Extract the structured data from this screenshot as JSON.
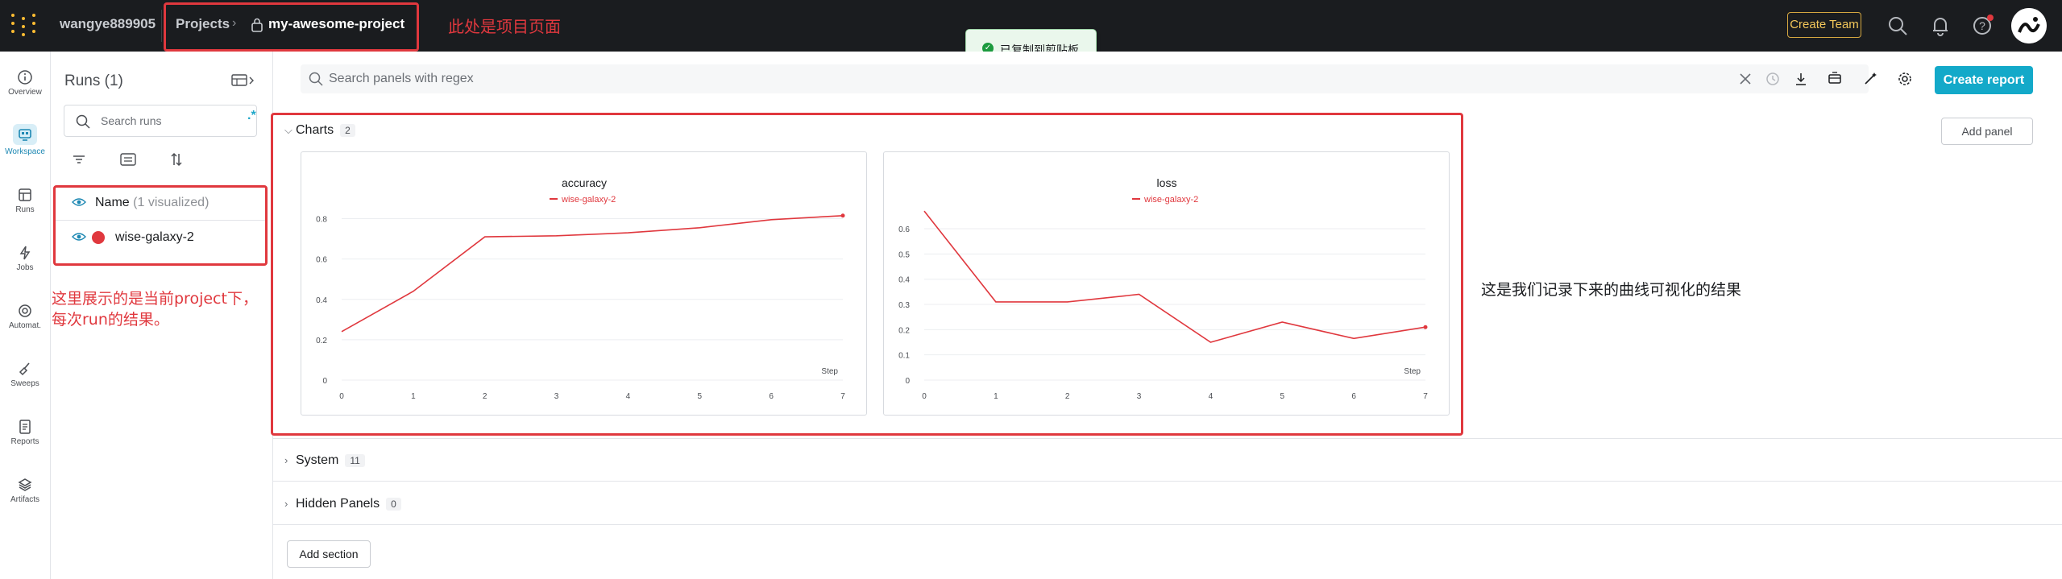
{
  "topbar": {
    "user": "wangye889905",
    "breadcrumb_projects": "Projects",
    "project_name": "my-awesome-project",
    "annotation": "此处是项目页面",
    "create_team": "Create Team"
  },
  "toast": {
    "text": "已复制到剪贴板"
  },
  "leftnav": {
    "items": [
      {
        "label": "Overview",
        "icon": "info-icon"
      },
      {
        "label": "Workspace",
        "icon": "workspace-icon"
      },
      {
        "label": "Runs",
        "icon": "table-icon"
      },
      {
        "label": "Jobs",
        "icon": "lightning-icon"
      },
      {
        "label": "Automat.",
        "icon": "automation-icon"
      },
      {
        "label": "Sweeps",
        "icon": "broom-icon"
      },
      {
        "label": "Reports",
        "icon": "report-icon"
      },
      {
        "label": "Artifacts",
        "icon": "layers-icon"
      }
    ]
  },
  "runs_panel": {
    "title": "Runs (1)",
    "search_placeholder": "Search runs",
    "regex_symbol": ".*",
    "header_name": "Name",
    "header_visualized": "(1 visualized)",
    "run_name": "wise-galaxy-2",
    "run_color": "#e0383e",
    "annotation_line1": "这里展示的是当前project下，",
    "annotation_line2": "每次run的结果。"
  },
  "main": {
    "search_placeholder": "Search panels with regex",
    "create_report": "Create report",
    "add_panel": "Add panel",
    "add_section": "Add section",
    "sections": [
      {
        "name": "Charts",
        "count": "2"
      },
      {
        "name": "System",
        "count": "11"
      },
      {
        "name": "Hidden Panels",
        "count": "0"
      }
    ],
    "annotation_right": "这是我们记录下来的曲线可视化的结果"
  },
  "chart_data": [
    {
      "type": "line",
      "title": "accuracy",
      "xlabel": "Step",
      "ylabel": "",
      "x": [
        0,
        1,
        2,
        3,
        4,
        5,
        6,
        7
      ],
      "xticks": [
        "0",
        "1",
        "2",
        "3",
        "4",
        "5",
        "6",
        "7"
      ],
      "yticks": [
        "0",
        "0.2",
        "0.4",
        "0.6",
        "0.8"
      ],
      "ylim": [
        0,
        0.85
      ],
      "series": [
        {
          "name": "wise-galaxy-2",
          "color": "#e0383e",
          "values": [
            0.24,
            0.44,
            0.71,
            0.715,
            0.73,
            0.755,
            0.795,
            0.815
          ]
        }
      ],
      "legend": "top-center",
      "grid": true
    },
    {
      "type": "line",
      "title": "loss",
      "xlabel": "Step",
      "ylabel": "",
      "x": [
        0,
        1,
        2,
        3,
        4,
        5,
        6,
        7
      ],
      "xticks": [
        "0",
        "1",
        "2",
        "3",
        "4",
        "5",
        "6",
        "7"
      ],
      "yticks": [
        "0",
        "0.1",
        "0.2",
        "0.3",
        "0.4",
        "0.5",
        "0.6"
      ],
      "ylim": [
        0,
        0.68
      ],
      "series": [
        {
          "name": "wise-galaxy-2",
          "color": "#e0383e",
          "values": [
            0.67,
            0.31,
            0.31,
            0.34,
            0.15,
            0.23,
            0.165,
            0.21
          ]
        }
      ],
      "legend": "top-center",
      "grid": true
    }
  ]
}
